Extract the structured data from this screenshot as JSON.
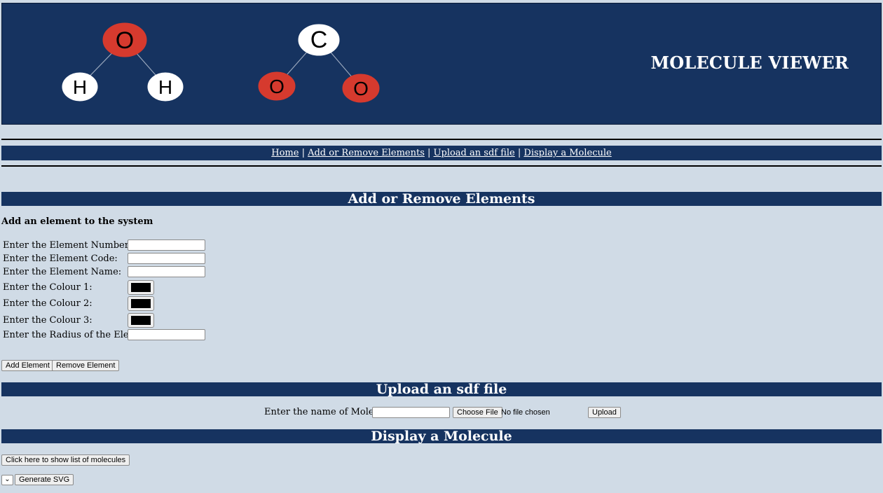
{
  "banner": {
    "title": "MOLECULE VIEWER",
    "water": {
      "top": "O",
      "left": "H",
      "right": "H"
    },
    "co2": {
      "top": "C",
      "left": "O",
      "right": "O"
    },
    "colors": {
      "banner_bg": "#163360",
      "oxygen": "#d63a2e",
      "hydrogen": "#ffffff",
      "carbon": "#ffffff"
    }
  },
  "nav": {
    "home": "Home",
    "sep1": "|",
    "add_remove": "Add or Remove Elements",
    "sep2": "|",
    "upload": "Upload an sdf file",
    "sep3": "|",
    "display": "Display a Molecule"
  },
  "add_remove": {
    "heading": "Add or Remove Elements",
    "subheading": "Add an element to the system",
    "labels": {
      "number": "Enter the Element Number:",
      "code": "Enter the Element Code:",
      "name": "Enter the Element Name:",
      "colour1": "Enter the Colour 1:",
      "colour2": "Enter the Colour 2:",
      "colour3": "Enter the Colour 3:",
      "radius": "Enter the Radius of the Element:"
    },
    "values": {
      "number": "",
      "code": "",
      "name": "",
      "radius": ""
    },
    "colour_values": {
      "colour1": "#000000",
      "colour2": "#000000",
      "colour3": "#000000"
    },
    "add_button": "Add Element",
    "remove_button": "Remove Element"
  },
  "upload": {
    "heading": "Upload an sdf file",
    "label": "Enter the name of Molecule:",
    "molecule_name": "",
    "choose_button": "Choose File",
    "file_status": "No file chosen",
    "upload_button": "Upload"
  },
  "display": {
    "heading": "Display a Molecule",
    "list_button": "Click here to show list of molecules",
    "select_value": "",
    "generate_button": "Generate SVG"
  }
}
